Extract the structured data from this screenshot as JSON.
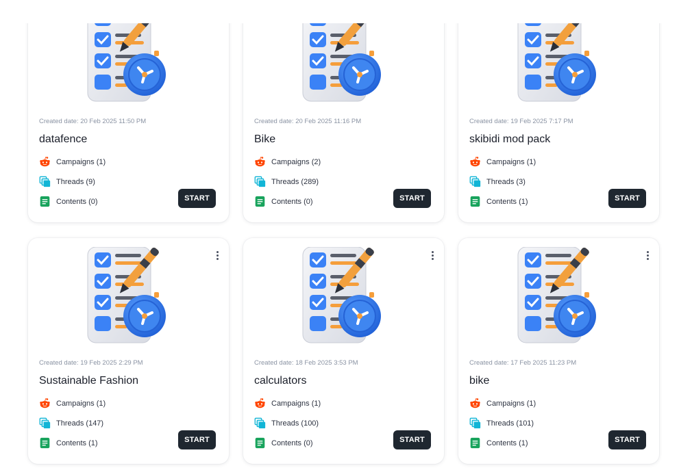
{
  "menu_icon": "more-vertical-icon",
  "stat_icons": {
    "campaigns": "reddit-icon",
    "threads": "threads-copy-icon",
    "contents": "document-icon"
  },
  "cards": [
    {
      "date": "Created date: 20 Feb 2025 11:50 PM",
      "title": "datafence",
      "campaigns": "Campaigns (1)",
      "threads": "Threads (9)",
      "contents": "Contents (0)",
      "start": "START"
    },
    {
      "date": "Created date: 20 Feb 2025 11:16 PM",
      "title": "Bike",
      "campaigns": "Campaigns (2)",
      "threads": "Threads (289)",
      "contents": "Contents (0)",
      "start": "START"
    },
    {
      "date": "Created date: 19 Feb 2025 7:17 PM",
      "title": "skibidi mod pack",
      "campaigns": "Campaigns (1)",
      "threads": "Threads (3)",
      "contents": "Contents (1)",
      "start": "START"
    },
    {
      "date": "Created date: 19 Feb 2025 2:29 PM",
      "title": "Sustainable Fashion",
      "campaigns": "Campaigns (1)",
      "threads": "Threads (147)",
      "contents": "Contents (1)",
      "start": "START"
    },
    {
      "date": "Created date: 18 Feb 2025 3:53 PM",
      "title": "calculators",
      "campaigns": "Campaigns (1)",
      "threads": "Threads (100)",
      "contents": "Contents (0)",
      "start": "START"
    },
    {
      "date": "Created date: 17 Feb 2025 11:23 PM",
      "title": "bike",
      "campaigns": "Campaigns (1)",
      "threads": "Threads (101)",
      "contents": "Contents (1)",
      "start": "START"
    }
  ]
}
